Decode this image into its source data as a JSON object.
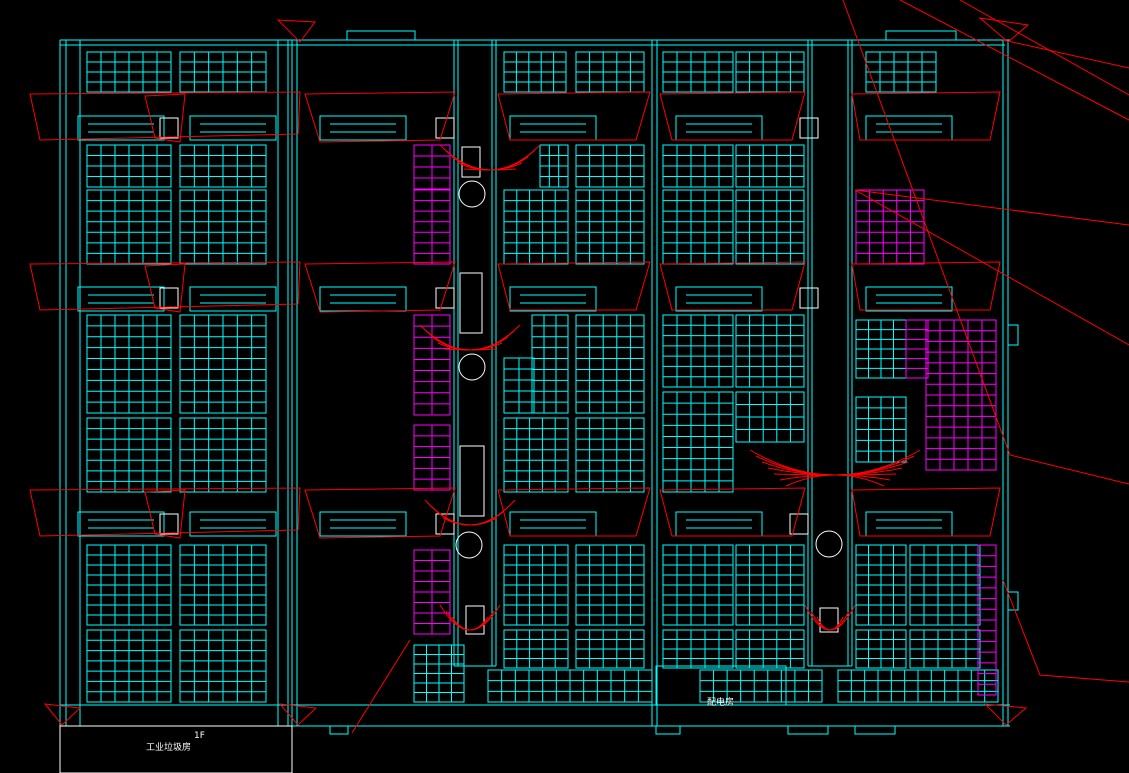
{
  "drawing": {
    "background": "#000000",
    "colors": {
      "structure": "#00ffff",
      "panel_array": "#00ffff",
      "highlighted_panels": "#ff00ff",
      "sun_path_markup": "#ff0000",
      "text": "#ffffff",
      "outline": "#ffffff"
    }
  },
  "labels": {
    "floor_label": "1F",
    "room_left": "工业垃圾房",
    "room_center": "配电房"
  }
}
